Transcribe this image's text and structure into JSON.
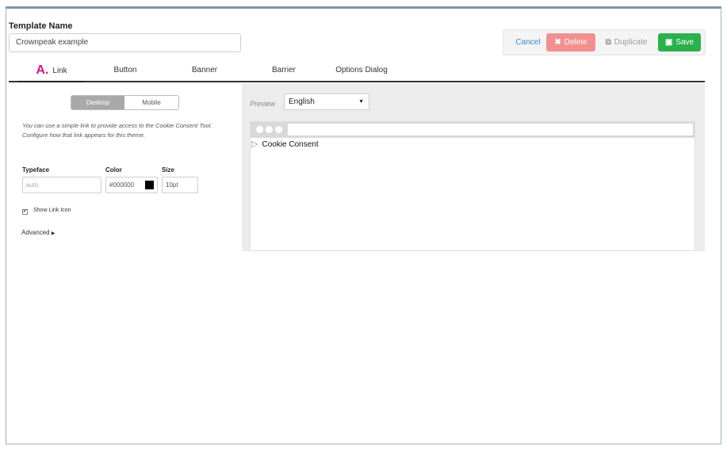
{
  "template": {
    "label": "Template Name",
    "value": "Crownpeak example"
  },
  "actions": {
    "cancel": "Cancel",
    "delete": "Delete",
    "duplicate": "Duplicate",
    "save": "Save"
  },
  "tabs": [
    {
      "marker": "A.",
      "label": "Link"
    },
    {
      "label": "Button"
    },
    {
      "label": "Banner"
    },
    {
      "label": "Barrier"
    },
    {
      "label": "Options Dialog"
    }
  ],
  "link_panel": {
    "devices": [
      "Desktop",
      "Mobile"
    ],
    "description": "You can use a simple link to provide access to the Cookie Consent Tool. Configure how that link appears for this theme.",
    "typeface": {
      "label": "Typeface",
      "placeholder": "auto"
    },
    "color": {
      "label": "Color",
      "value": "#000000"
    },
    "size": {
      "label": "Size",
      "value": "10pt"
    },
    "show_link_icon": "Show Link Icon",
    "advanced": "Advanced"
  },
  "preview": {
    "label": "Preview",
    "language": "English",
    "link_text": "Cookie Consent"
  },
  "colors": {
    "accent": "#2a8fc9",
    "delete": "#f29090",
    "save": "#2bb04c",
    "tab_marker": "#d0197b"
  }
}
